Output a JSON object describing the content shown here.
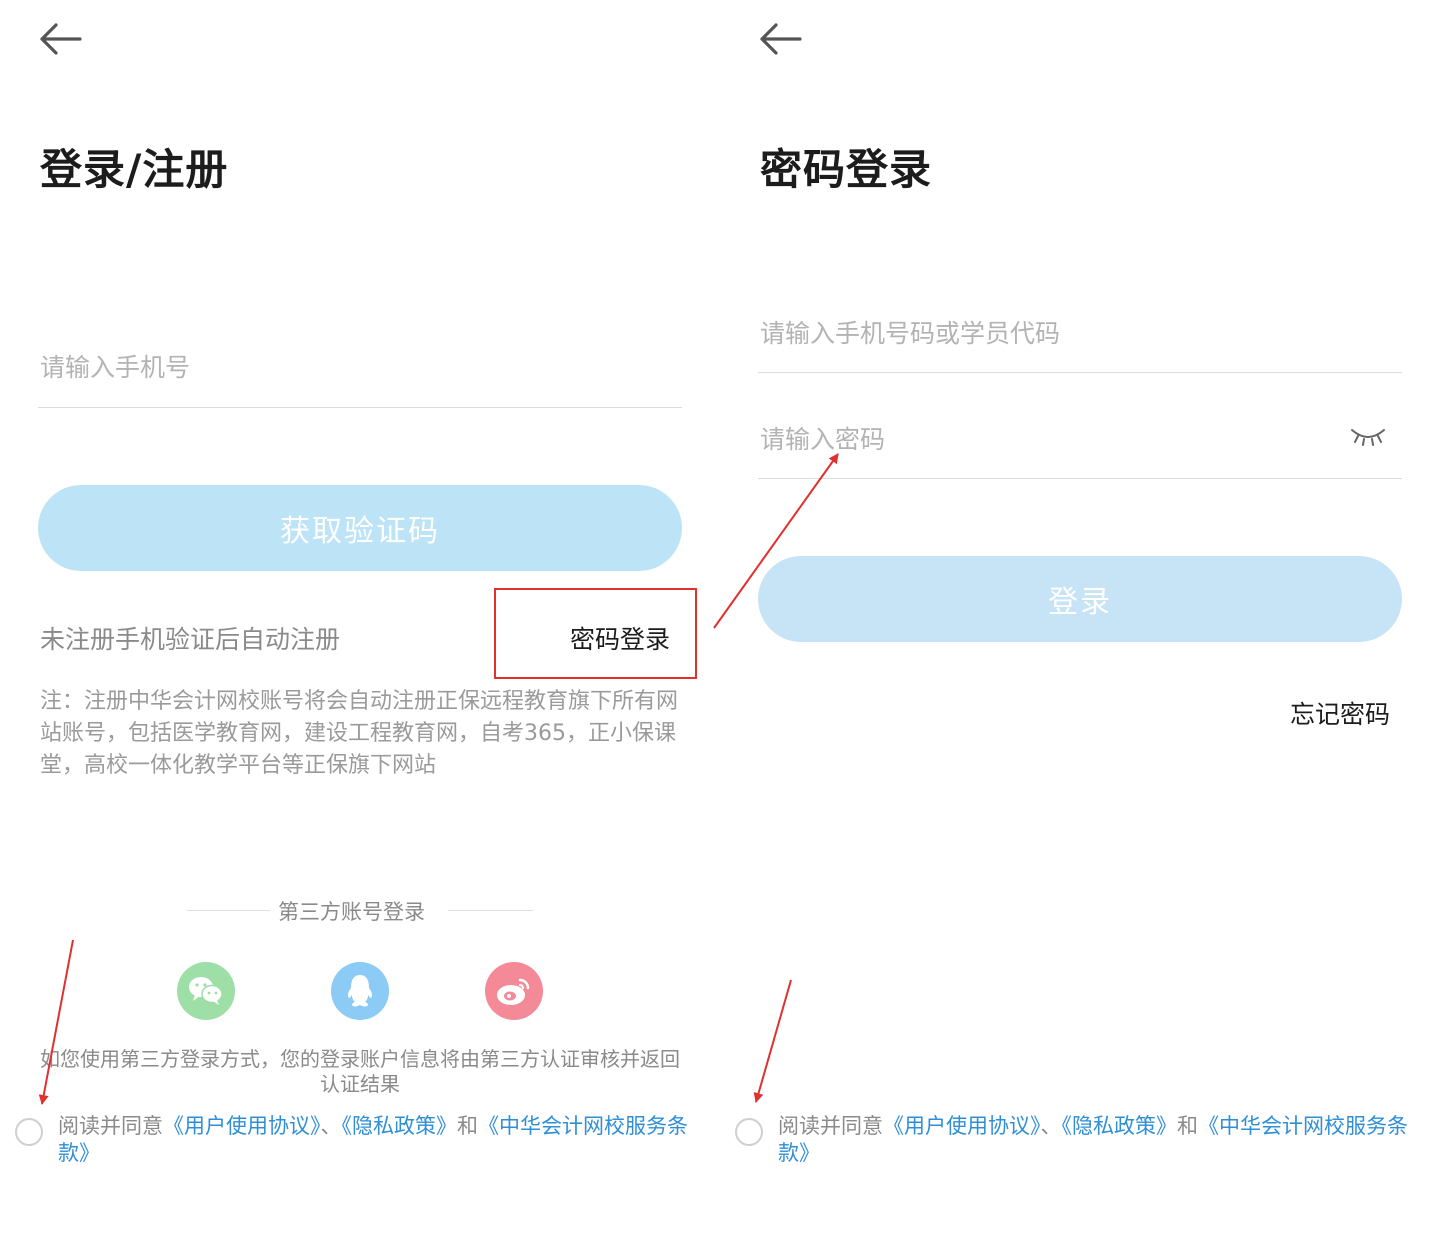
{
  "colors": {
    "button_left_bg": "#bde3f7",
    "button_right_bg": "#c6e4f6",
    "link_blue": "#2f8fd6",
    "annotation_red": "#e03030",
    "wechat": "#9ddfa6",
    "qq": "#8ccbf5",
    "weibo": "#f48a98"
  },
  "left": {
    "back_icon": "arrow-left",
    "title": "登录/注册",
    "phone_placeholder": "请输入手机号",
    "get_code_label": "获取验证码",
    "auto_register_text": "未注册手机验证后自动注册",
    "password_login_link": "密码登录",
    "note_text": "注：注册中华会计网校账号将会自动注册正保远程教育旗下所有网站账号，包括医学教育网，建设工程教育网，自考365，正小保课堂，高校一体化教学平台等正保旗下网站",
    "third_party_title": "第三方账号登录",
    "social_icons": [
      "wechat-icon",
      "qq-icon",
      "weibo-icon"
    ],
    "third_party_notice": "如您使用第三方登录方式，您的登录账户信息将由第三方认证审核并返回认证结果",
    "agree_prefix": "阅读并同意",
    "agree_link1": "《用户使用协议》",
    "agree_sep": "、",
    "agree_link2": "《隐私政策》",
    "agree_and": "和",
    "agree_link3": "《中华会计网校服务条款》"
  },
  "right": {
    "back_icon": "arrow-left",
    "title": "密码登录",
    "account_placeholder": "请输入手机号码或学员代码",
    "password_placeholder": "请输入密码",
    "eye_icon": "eye-closed",
    "login_label": "登录",
    "forgot_password": "忘记密码",
    "agree_prefix": "阅读并同意",
    "agree_link1": "《用户使用协议》",
    "agree_sep": "、",
    "agree_link2": "《隐私政策》",
    "agree_and": "和",
    "agree_link3": "《中华会计网校服务条款》"
  }
}
